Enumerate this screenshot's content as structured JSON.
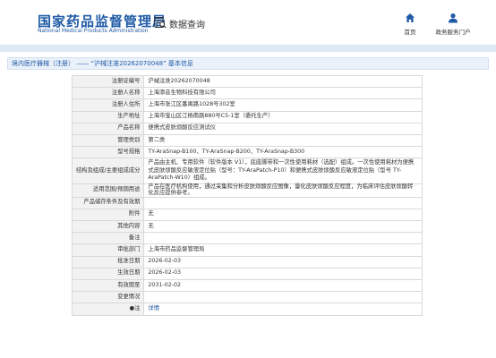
{
  "header": {
    "site_title": "国家药品监督管理局",
    "site_subtitle": "National Medical Products Administration",
    "query_title": "数据查询",
    "nav": [
      {
        "label": "首页",
        "icon": "home-icon"
      },
      {
        "label": "政务服务门户",
        "icon": "user-icon"
      }
    ]
  },
  "breadcrumb": {
    "text": "境内医疗器械（注册） —— “沪械注准20262070048” 基本信息"
  },
  "detail": {
    "rows": [
      {
        "key": "注册证编号",
        "value": "沪械注准20262070048"
      },
      {
        "key": "注册人名称",
        "value": "上海添音生物科技有限公司"
      },
      {
        "key": "注册人住所",
        "value": "上海市张江区番禺路1028号302室"
      },
      {
        "key": "生产地址",
        "value": "上海市宝山区江杨南路880号C5-1室（委托生产）"
      },
      {
        "key": "产品名称",
        "value": "便携式皮肤烦酸反应测试仪"
      },
      {
        "key": "管理类别",
        "value": "第二类"
      },
      {
        "key": "型号规格",
        "value": "TY-AraSnap-B100、TY-AraSnap-B200、TY-AraSnap-B300"
      },
      {
        "key": "结构及组成/主要组成成分",
        "value": "产品由主机、专用软件（软件版本 V1），底座脚带和一次性使用耗材（选配）组成。一次性使用耗材为便携式皮肤烦酸反应敏液定位贴（型号：TY-AraPatch-P10）和便携式皮肤烦酸反应敏液定位贴（型号 TY-AraPatch-W10）组成。",
        "tall": true
      },
      {
        "key": "适用范围/预期用途",
        "value": "产品在医疗机构使用，通过采集和分析皮肤烦酸反应图像，量化皮肤烦酸反应程度，为临床评估皮肤烦酸转化反应提供参考。"
      },
      {
        "key": "产品储存条件及有效期",
        "value": ""
      },
      {
        "key": "附件",
        "value": "无"
      },
      {
        "key": "其他内容",
        "value": "无"
      },
      {
        "key": "备注",
        "value": ""
      },
      {
        "key": "审批部门",
        "value": "上海市药品监督管理局"
      },
      {
        "key": "批准日期",
        "value": "2026-02-03"
      },
      {
        "key": "生效日期",
        "value": "2026-02-03"
      },
      {
        "key": "有效期至",
        "value": "2031-02-02"
      },
      {
        "key": "变更情况",
        "value": ""
      },
      {
        "key": "●注",
        "value": "详情",
        "link": true
      }
    ]
  },
  "colors": {
    "brand_blue": "#1f5aa6",
    "key_cell_bg": "#f2f2f2",
    "border": "#d9d9d9"
  }
}
